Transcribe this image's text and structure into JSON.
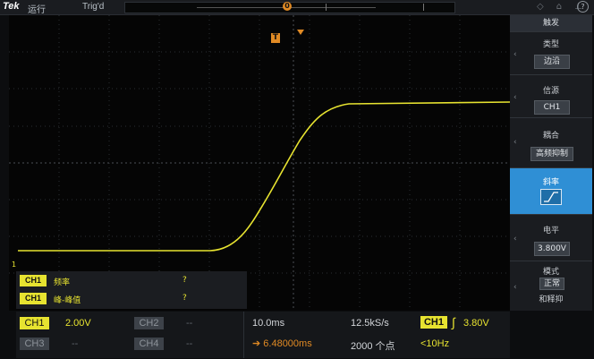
{
  "topbar": {
    "brand": "Tek",
    "run_state": "运行",
    "trigger_state": "Trig'd",
    "waveform_marker": "0"
  },
  "colors": {
    "ch1": "#e7e330",
    "trigger": "#e08a24",
    "active_menu": "#2f8fd5"
  },
  "screen": {
    "trigger_marker": "T",
    "ch1_ground_marker": "1"
  },
  "measurements": [
    {
      "channel": "CH1",
      "label": "频率",
      "value": "?"
    },
    {
      "channel": "CH1",
      "label": "峰-峰值",
      "value": "?"
    }
  ],
  "bottom": {
    "ch1": {
      "name": "CH1",
      "scale": "2.00V"
    },
    "ch2": {
      "name": "CH2",
      "scale": "--"
    },
    "ch3": {
      "name": "CH3",
      "scale": "--"
    },
    "ch4": {
      "name": "CH4",
      "scale": "--"
    },
    "timebase": "10.0ms",
    "position": "6.48000ms",
    "sample_rate": "12.5kS/s",
    "record_length": "2000 个点",
    "trigger_source": "CH1",
    "trigger_level": "3.80V",
    "trigger_freq": "<10Hz"
  },
  "side_menu": {
    "title": "触发",
    "type_label": "类型",
    "type_value": "边沿",
    "source_label": "信源",
    "source_value": "CH1",
    "coupling_label": "耦合",
    "coupling_value": "高频抑制",
    "slope_label": "斜率",
    "level_label": "电平",
    "level_value": "3.800V",
    "mode_label": "模式",
    "mode_value": "正常",
    "holdoff_label": "和释抑"
  }
}
